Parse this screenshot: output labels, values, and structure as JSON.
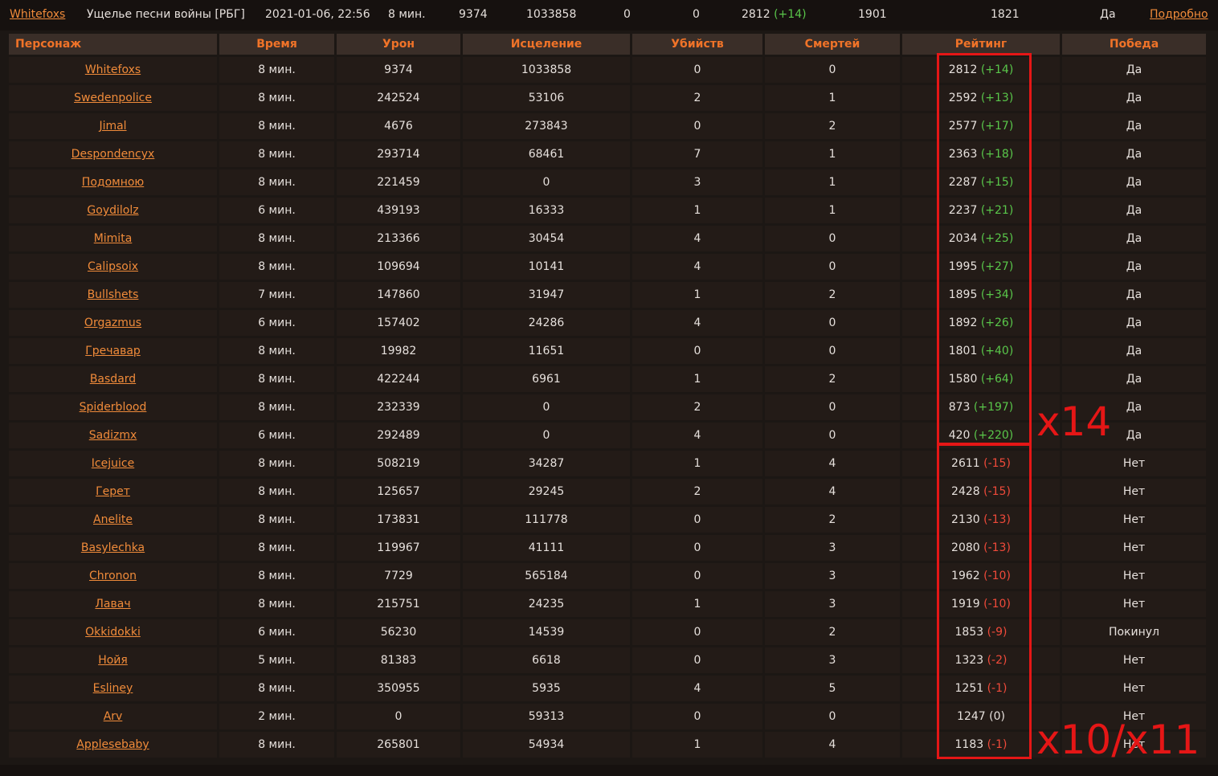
{
  "summary": {
    "player": "Whitefoxs",
    "map": "Ущелье песни войны [РБГ]",
    "date": "2021-01-06, 22:56",
    "time": "8 мин.",
    "damage": "9374",
    "healing": "1033858",
    "kills": "0",
    "deaths": "0",
    "rating": "2812",
    "rating_delta": "(+14)",
    "mmr1": "1901",
    "mmr2": "1821",
    "victory": "Да",
    "details_link": "Подробно"
  },
  "headers": {
    "character": "Персонаж",
    "time": "Время",
    "damage": "Урон",
    "healing": "Исцеление",
    "kills": "Убийств",
    "deaths": "Смертей",
    "rating": "Рейтинг",
    "victory": "Победа"
  },
  "rows": [
    {
      "name": "Whitefoxs",
      "time": "8 мин.",
      "damage": "9374",
      "heal": "1033858",
      "kills": "0",
      "deaths": "0",
      "rating": "2812",
      "delta": "(+14)",
      "sign": "pos",
      "win": "Да"
    },
    {
      "name": "Swedenpolice",
      "time": "8 мин.",
      "damage": "242524",
      "heal": "53106",
      "kills": "2",
      "deaths": "1",
      "rating": "2592",
      "delta": "(+13)",
      "sign": "pos",
      "win": "Да"
    },
    {
      "name": "Jimal",
      "time": "8 мин.",
      "damage": "4676",
      "heal": "273843",
      "kills": "0",
      "deaths": "2",
      "rating": "2577",
      "delta": "(+17)",
      "sign": "pos",
      "win": "Да"
    },
    {
      "name": "Despondencyx",
      "time": "8 мин.",
      "damage": "293714",
      "heal": "68461",
      "kills": "7",
      "deaths": "1",
      "rating": "2363",
      "delta": "(+18)",
      "sign": "pos",
      "win": "Да"
    },
    {
      "name": "Подомною",
      "time": "8 мин.",
      "damage": "221459",
      "heal": "0",
      "kills": "3",
      "deaths": "1",
      "rating": "2287",
      "delta": "(+15)",
      "sign": "pos",
      "win": "Да"
    },
    {
      "name": "Goydilolz",
      "time": "6 мин.",
      "damage": "439193",
      "heal": "16333",
      "kills": "1",
      "deaths": "1",
      "rating": "2237",
      "delta": "(+21)",
      "sign": "pos",
      "win": "Да"
    },
    {
      "name": "Mimita",
      "time": "8 мин.",
      "damage": "213366",
      "heal": "30454",
      "kills": "4",
      "deaths": "0",
      "rating": "2034",
      "delta": "(+25)",
      "sign": "pos",
      "win": "Да"
    },
    {
      "name": "Calipsoix",
      "time": "8 мин.",
      "damage": "109694",
      "heal": "10141",
      "kills": "4",
      "deaths": "0",
      "rating": "1995",
      "delta": "(+27)",
      "sign": "pos",
      "win": "Да"
    },
    {
      "name": "Bullshets",
      "time": "7 мин.",
      "damage": "147860",
      "heal": "31947",
      "kills": "1",
      "deaths": "2",
      "rating": "1895",
      "delta": "(+34)",
      "sign": "pos",
      "win": "Да"
    },
    {
      "name": "Orgazmus",
      "time": "6 мин.",
      "damage": "157402",
      "heal": "24286",
      "kills": "4",
      "deaths": "0",
      "rating": "1892",
      "delta": "(+26)",
      "sign": "pos",
      "win": "Да"
    },
    {
      "name": "Гречавар",
      "time": "8 мин.",
      "damage": "19982",
      "heal": "11651",
      "kills": "0",
      "deaths": "0",
      "rating": "1801",
      "delta": "(+40)",
      "sign": "pos",
      "win": "Да"
    },
    {
      "name": "Basdard",
      "time": "8 мин.",
      "damage": "422244",
      "heal": "6961",
      "kills": "1",
      "deaths": "2",
      "rating": "1580",
      "delta": "(+64)",
      "sign": "pos",
      "win": "Да"
    },
    {
      "name": "Spiderblood",
      "time": "8 мин.",
      "damage": "232339",
      "heal": "0",
      "kills": "2",
      "deaths": "0",
      "rating": "873",
      "delta": "(+197)",
      "sign": "pos",
      "win": "Да"
    },
    {
      "name": "Sadizmx",
      "time": "6 мин.",
      "damage": "292489",
      "heal": "0",
      "kills": "4",
      "deaths": "0",
      "rating": "420",
      "delta": "(+220)",
      "sign": "pos",
      "win": "Да"
    },
    {
      "name": "Icejuice",
      "time": "8 мин.",
      "damage": "508219",
      "heal": "34287",
      "kills": "1",
      "deaths": "4",
      "rating": "2611",
      "delta": "(-15)",
      "sign": "neg",
      "win": "Нет"
    },
    {
      "name": "Герет",
      "time": "8 мин.",
      "damage": "125657",
      "heal": "29245",
      "kills": "2",
      "deaths": "4",
      "rating": "2428",
      "delta": "(-15)",
      "sign": "neg",
      "win": "Нет"
    },
    {
      "name": "Anelite",
      "time": "8 мин.",
      "damage": "173831",
      "heal": "111778",
      "kills": "0",
      "deaths": "2",
      "rating": "2130",
      "delta": "(-13)",
      "sign": "neg",
      "win": "Нет"
    },
    {
      "name": "Basylechka",
      "time": "8 мин.",
      "damage": "119967",
      "heal": "41111",
      "kills": "0",
      "deaths": "3",
      "rating": "2080",
      "delta": "(-13)",
      "sign": "neg",
      "win": "Нет"
    },
    {
      "name": "Chronon",
      "time": "8 мин.",
      "damage": "7729",
      "heal": "565184",
      "kills": "0",
      "deaths": "3",
      "rating": "1962",
      "delta": "(-10)",
      "sign": "neg",
      "win": "Нет"
    },
    {
      "name": "Лавач",
      "time": "8 мин.",
      "damage": "215751",
      "heal": "24235",
      "kills": "1",
      "deaths": "3",
      "rating": "1919",
      "delta": "(-10)",
      "sign": "neg",
      "win": "Нет"
    },
    {
      "name": "Okkidokki",
      "time": "6 мин.",
      "damage": "56230",
      "heal": "14539",
      "kills": "0",
      "deaths": "2",
      "rating": "1853",
      "delta": "(-9)",
      "sign": "neg",
      "win": "Покинул"
    },
    {
      "name": "Нойя",
      "time": "5 мин.",
      "damage": "81383",
      "heal": "6618",
      "kills": "0",
      "deaths": "3",
      "rating": "1323",
      "delta": "(-2)",
      "sign": "neg",
      "win": "Нет"
    },
    {
      "name": "Esliney",
      "time": "8 мин.",
      "damage": "350955",
      "heal": "5935",
      "kills": "4",
      "deaths": "5",
      "rating": "1251",
      "delta": "(-1)",
      "sign": "neg",
      "win": "Нет"
    },
    {
      "name": "Arv",
      "time": "2 мин.",
      "damage": "0",
      "heal": "59313",
      "kills": "0",
      "deaths": "0",
      "rating": "1247",
      "delta": "(0)",
      "sign": "zero",
      "win": "Нет"
    },
    {
      "name": "Applesebaby",
      "time": "8 мин.",
      "damage": "265801",
      "heal": "54934",
      "kills": "1",
      "deaths": "4",
      "rating": "1183",
      "delta": "(-1)",
      "sign": "neg",
      "win": "Нет"
    }
  ],
  "annotations": {
    "winners": "x14",
    "losers": "x10/x11"
  },
  "colors": {
    "accent": "#f07328",
    "link": "#f08b3a",
    "positive": "#59c64a",
    "negative": "#f04a3a",
    "annotation": "#e51616"
  }
}
